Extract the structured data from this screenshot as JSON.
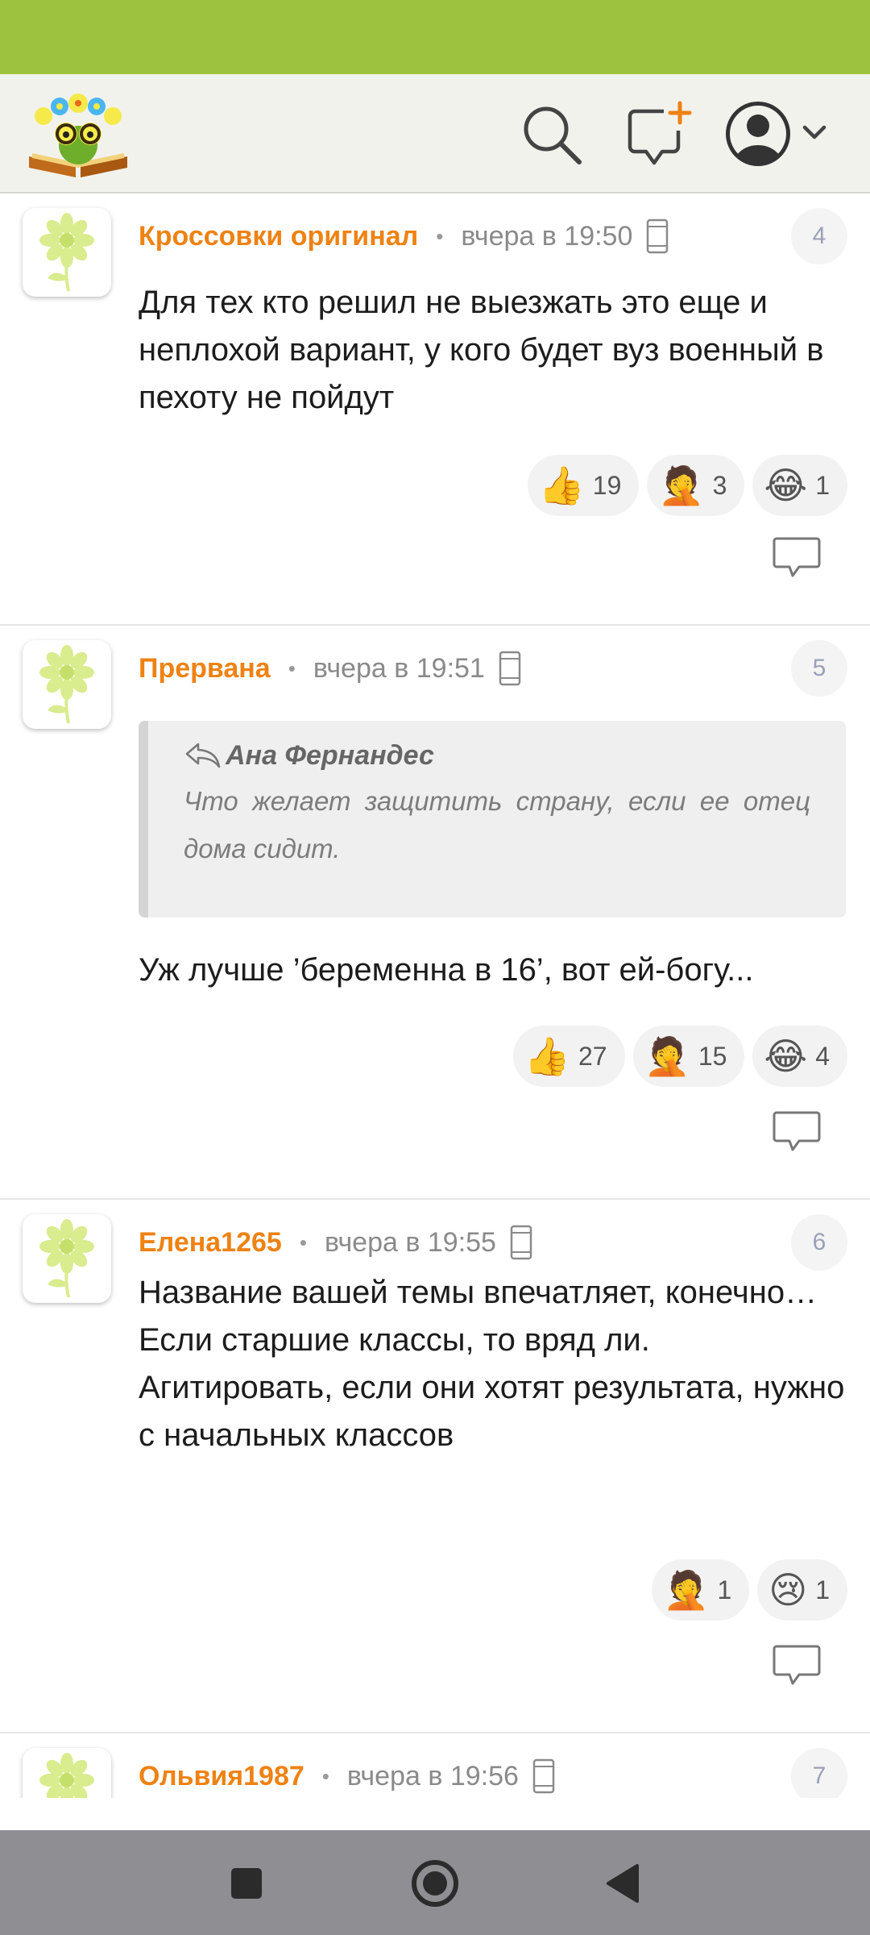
{
  "comments": [
    {
      "author": "Кроссовки оригинал",
      "time": "вчера в 19:50",
      "number": "4",
      "text": "Для тех кто решил не выезжать это еще и неплохой вариант, у кого будет вуз военный в пехоту не пойдут",
      "reactions": [
        {
          "icon": "thumbs-up",
          "emoji": "👍",
          "count": "19"
        },
        {
          "icon": "facepalm",
          "emoji": "🤦",
          "count": "3"
        },
        {
          "icon": "tears-of-joy",
          "emoji": "😂",
          "count": "1"
        }
      ]
    },
    {
      "author": "Прервана",
      "time": "вчера в 19:51",
      "number": "5",
      "quote": {
        "author": "Ана Фернандес",
        "text": "Что желает защитить страну, если ее отец дома сидит."
      },
      "text": "Уж лучше ’беременна в 16’, вот ей-богу...",
      "reactions": [
        {
          "icon": "thumbs-up",
          "emoji": "👍",
          "count": "27"
        },
        {
          "icon": "facepalm",
          "emoji": "🤦",
          "count": "15"
        },
        {
          "icon": "tears-of-joy",
          "emoji": "😂",
          "count": "4"
        }
      ]
    },
    {
      "author": "Елена1265",
      "time": "вчера в 19:55",
      "number": "6",
      "text": "Название вашей темы впечатляет, конечно…\nЕсли старшие классы, то вряд ли. Агитировать, если они хотят результата, нужно с начальных классов",
      "reactions": [
        {
          "icon": "facepalm",
          "emoji": "🤦",
          "count": "1"
        },
        {
          "icon": "crying-face",
          "emoji": "😢",
          "count": "1"
        }
      ]
    },
    {
      "author": "Ольвия1987",
      "time": "вчера в 19:56",
      "number": "7"
    }
  ],
  "colors": {
    "status_bar": "#9dc23f",
    "header_bg": "#f2f2ec",
    "author": "#ee8213",
    "nav_bar": "#8e8e93"
  },
  "icons": {
    "header": [
      "logo",
      "search-icon",
      "new-message-icon",
      "profile-icon",
      "chevron-down-icon"
    ],
    "navigation": [
      "recent-apps-icon",
      "home-icon",
      "back-icon"
    ]
  }
}
